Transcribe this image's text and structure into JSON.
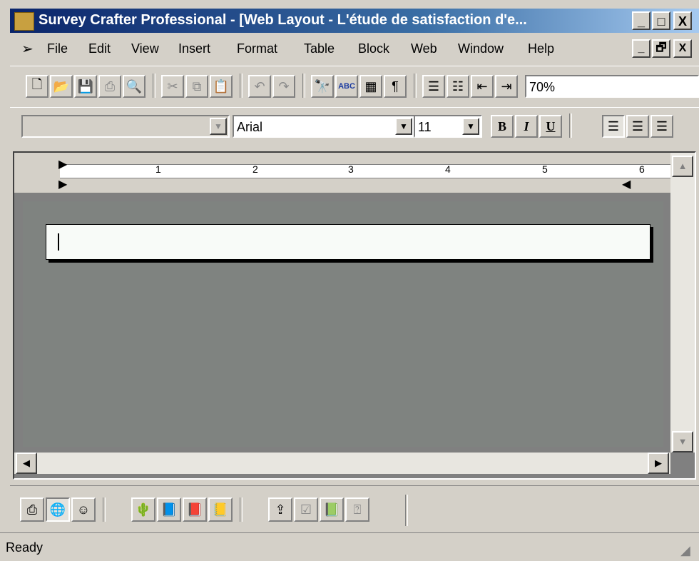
{
  "window": {
    "title": "Survey Crafter Professional - [Web Layout - L'étude de satisfaction d'e...",
    "caption_buttons": [
      "_",
      "□",
      "X"
    ]
  },
  "menu": {
    "items": [
      {
        "label": "File"
      },
      {
        "label": "Edit"
      },
      {
        "label": "View"
      },
      {
        "label": "Insert"
      },
      {
        "label": "Format"
      },
      {
        "label": "Table"
      },
      {
        "label": "Block"
      },
      {
        "label": "Web"
      },
      {
        "label": "Window"
      },
      {
        "label": "Help"
      }
    ],
    "mdi_buttons": [
      "_",
      "🗗",
      "X"
    ]
  },
  "standard_toolbar": {
    "zoom": "70%"
  },
  "format_toolbar": {
    "style_value": "",
    "font_value": "Arial",
    "size_value": "11",
    "bold": "B",
    "italic": "I",
    "underline": "U"
  },
  "ruler": {
    "numbers": [
      "1",
      "2",
      "3",
      "4",
      "5",
      "6"
    ]
  },
  "status": {
    "text": "Ready"
  },
  "icons": {
    "standard": [
      "new-icon",
      "open-icon",
      "save-icon",
      "print-icon",
      "print-preview-icon",
      "cut-icon",
      "copy-icon",
      "paste-icon",
      "undo-icon",
      "redo-icon",
      "find-icon",
      "spelling-icon",
      "insert-table-icon",
      "show-formatting-icon",
      "numbering-icon",
      "bullets-icon",
      "decrease-indent-icon",
      "increase-indent-icon"
    ],
    "bottom": [
      "print-layout-icon",
      "web-layout-icon",
      "respondent-view-icon",
      "insert-image-icon",
      "block-1-icon",
      "block-2-icon",
      "block-3-icon",
      "export-icon",
      "check-icon",
      "help-book-icon",
      "help-context-icon"
    ]
  }
}
